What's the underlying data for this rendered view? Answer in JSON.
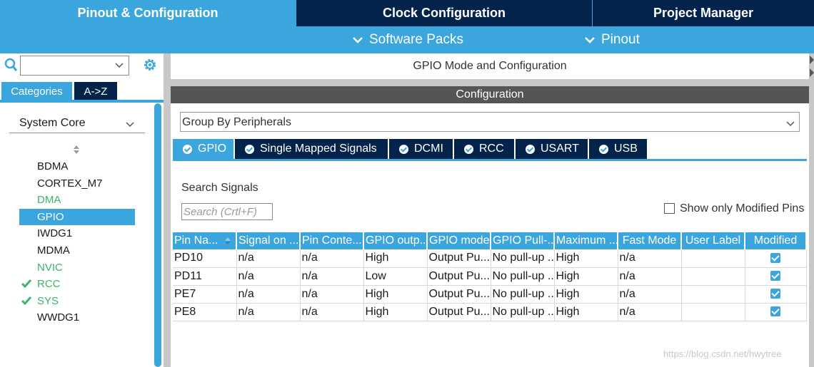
{
  "top_tabs": [
    {
      "label": "Pinout & Configuration",
      "active": true
    },
    {
      "label": "Clock Configuration",
      "active": false
    },
    {
      "label": "Project Manager",
      "active": false
    }
  ],
  "secondary": {
    "software_packs": "Software Packs",
    "pinout": "Pinout"
  },
  "left": {
    "search_value": "",
    "tabs": {
      "categories": "Categories",
      "az": "A->Z"
    },
    "section": "System Core",
    "items": [
      {
        "label": "BDMA",
        "style": "normal",
        "checked": false
      },
      {
        "label": "CORTEX_M7",
        "style": "normal",
        "checked": false
      },
      {
        "label": "DMA",
        "style": "green",
        "checked": false
      },
      {
        "label": "GPIO",
        "style": "selected",
        "checked": false
      },
      {
        "label": "IWDG1",
        "style": "normal",
        "checked": false
      },
      {
        "label": "MDMA",
        "style": "normal",
        "checked": false
      },
      {
        "label": "NVIC",
        "style": "green",
        "checked": false
      },
      {
        "label": "RCC",
        "style": "green",
        "checked": true
      },
      {
        "label": "SYS",
        "style": "green",
        "checked": true
      },
      {
        "label": "WWDG1",
        "style": "normal",
        "checked": false
      }
    ]
  },
  "main": {
    "mode_header": "GPIO Mode and Configuration",
    "config_header": "Configuration",
    "group_by": "Group By Peripherals",
    "periph_tabs": [
      "GPIO",
      "Single Mapped Signals",
      "DCMI",
      "RCC",
      "USART",
      "USB"
    ],
    "search_label": "Search Signals",
    "search_placeholder": "Search (Crtl+F)",
    "show_modified_label": "Show only Modified Pins",
    "table": {
      "headers": [
        "Pin Na...",
        "Signal on ...",
        "Pin Conte...",
        "GPIO outp...",
        "GPIO mode",
        "GPIO Pull-...",
        "Maximum ...",
        "Fast Mode",
        "User Label",
        "Modified"
      ],
      "rows": [
        [
          "PD10",
          "n/a",
          "n/a",
          "High",
          "Output Pu...",
          "No pull-up ...",
          "High",
          "n/a",
          "",
          true
        ],
        [
          "PD11",
          "n/a",
          "n/a",
          "Low",
          "Output Pu...",
          "No pull-up ...",
          "High",
          "n/a",
          "",
          true
        ],
        [
          "PE7",
          "n/a",
          "n/a",
          "High",
          "Output Pu...",
          "No pull-up ...",
          "High",
          "n/a",
          "",
          true
        ],
        [
          "PE8",
          "n/a",
          "n/a",
          "High",
          "Output Pu...",
          "No pull-up ...",
          "High",
          "n/a",
          "",
          true
        ]
      ]
    }
  },
  "watermark": "https://blog.csdn.net/hwytree",
  "colors": {
    "accent": "#3aa6dd",
    "dark_navy": "#03234b",
    "green": "#3cb46e",
    "header_gray": "#555555"
  }
}
